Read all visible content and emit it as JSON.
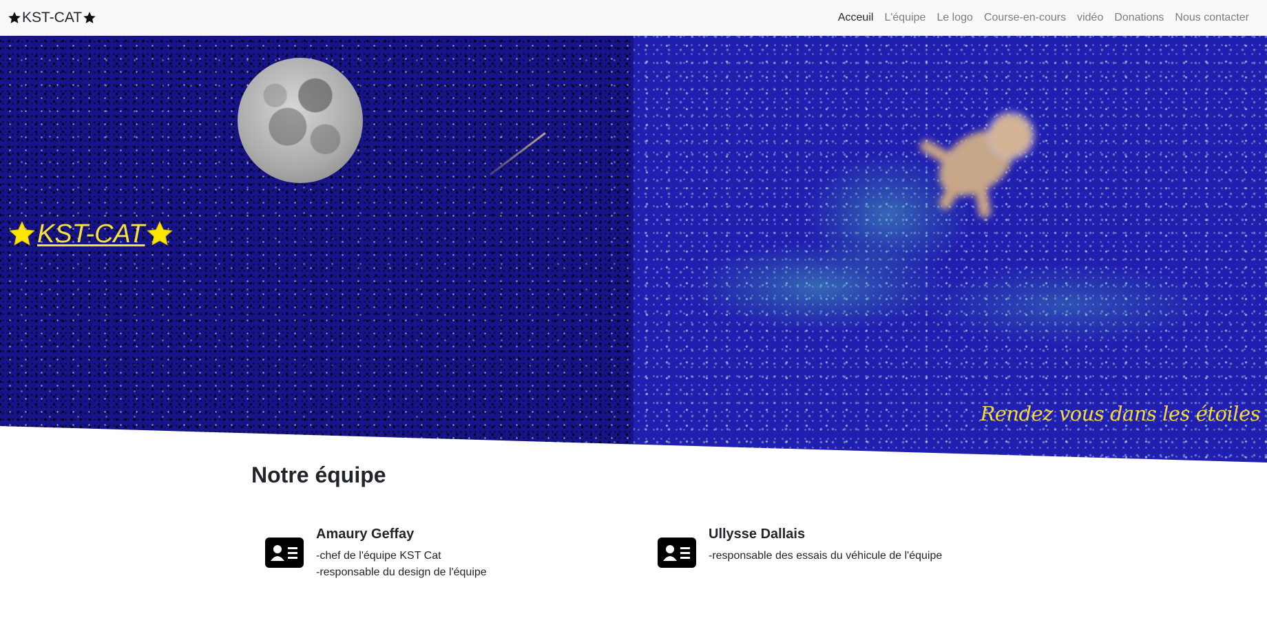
{
  "navbar": {
    "brand": "KST-CAT",
    "links": [
      {
        "label": "Acceuil",
        "active": true
      },
      {
        "label": "L'équipe",
        "active": false
      },
      {
        "label": "Le logo",
        "active": false
      },
      {
        "label": "Course-en-cours",
        "active": false
      },
      {
        "label": "vidéo",
        "active": false
      },
      {
        "label": "Donations",
        "active": false
      },
      {
        "label": "Nous contacter",
        "active": false
      }
    ]
  },
  "hero": {
    "title": "KST-CAT",
    "tagline": "Rendez vous dans les étoiles"
  },
  "team": {
    "heading": "Notre équipe",
    "members": [
      {
        "name": "Amaury Geffay",
        "roles": [
          "-chef de l'équipe KST Cat",
          "-responsable du design de l'équipe"
        ]
      },
      {
        "name": "Ullysse Dallais",
        "roles": [
          "-responsable des essais du véhicule de l'équipe"
        ]
      }
    ]
  },
  "colors": {
    "navbar_bg": "#f8f9fa",
    "hero_title": "#f5e23a",
    "tagline": "#f5d93a",
    "sky_left": "#17138a",
    "sky_right": "#211fb0"
  },
  "icons": {
    "brand_star": "star-icon",
    "member_card": "id-card-icon"
  }
}
